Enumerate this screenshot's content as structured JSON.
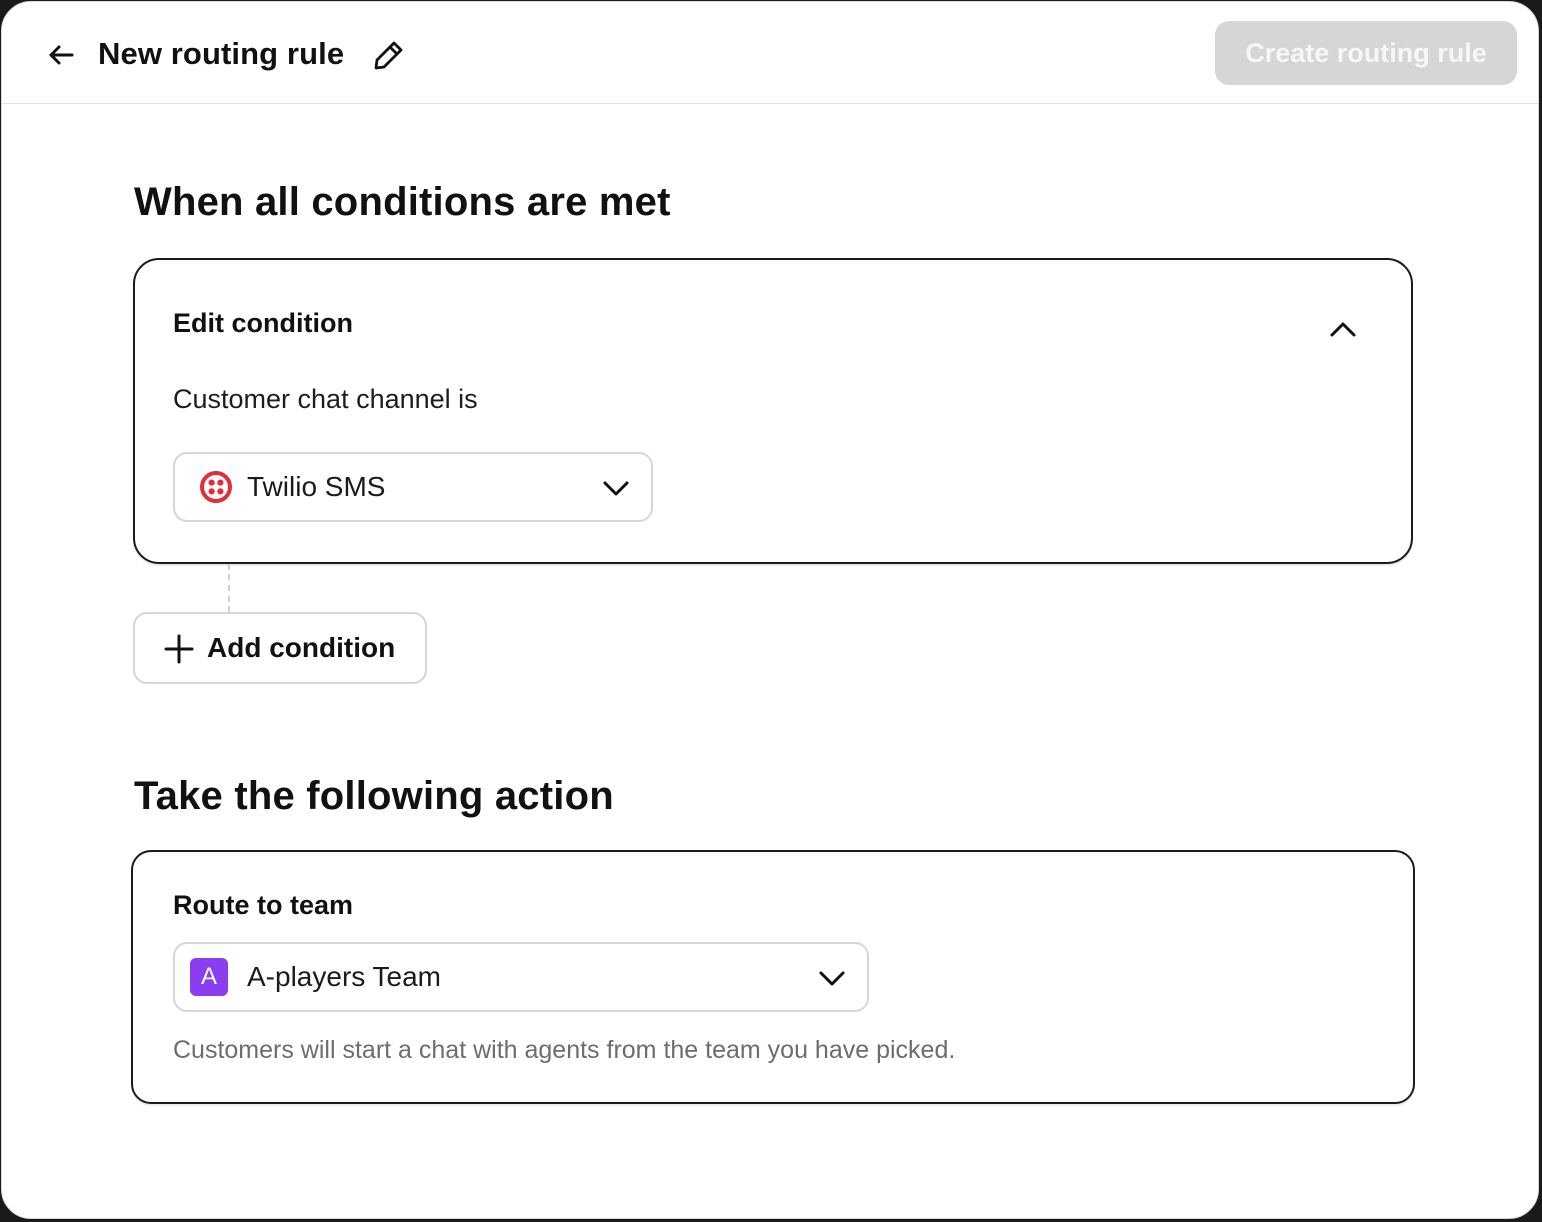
{
  "header": {
    "title": "New routing rule",
    "create_button_label": "Create routing rule"
  },
  "conditions_section": {
    "heading": "When all conditions are met",
    "condition_card": {
      "title": "Edit condition",
      "label": "Customer chat channel is",
      "channel_select": {
        "value": "Twilio SMS",
        "icon": "twilio-logo-icon"
      }
    },
    "add_condition_label": "Add condition"
  },
  "action_section": {
    "heading": "Take the following action",
    "action_card": {
      "title": "Route to team",
      "team_select": {
        "avatar_letter": "A",
        "value": "A-players Team"
      },
      "helper_text": "Customers will start a chat with agents from the team you have picked."
    }
  },
  "colors": {
    "twilio_red": "#e22d3b",
    "team_avatar_purple": "#8b3df0",
    "disabled_button_bg": "#d6d6d6",
    "card_border": "#1b1b1b"
  },
  "icons": {
    "back": "arrow-left-icon",
    "edit_title": "pencil-icon",
    "collapse": "chevron-up-icon",
    "dropdown": "chevron-down-icon",
    "add": "plus-icon"
  }
}
